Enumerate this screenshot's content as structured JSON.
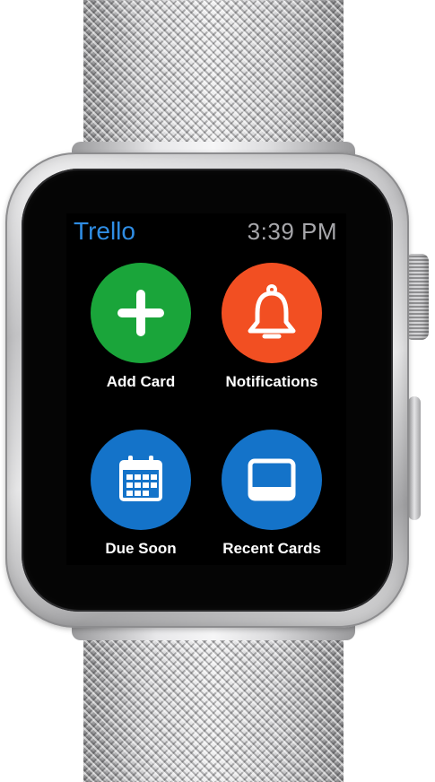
{
  "app": {
    "title": "Trello",
    "time": "3:39 PM"
  },
  "colors": {
    "title_blue": "#2f8de4",
    "add_card_green": "#1aa53a",
    "notifications_orange": "#f24f22",
    "due_soon_blue": "#1473c9",
    "recent_cards_blue": "#1473c9"
  },
  "actions": [
    {
      "label": "Add Card",
      "icon": "plus-icon"
    },
    {
      "label": "Notifications",
      "icon": "bell-icon"
    },
    {
      "label": "Due Soon",
      "icon": "calendar-icon"
    },
    {
      "label": "Recent Cards",
      "icon": "card-icon"
    }
  ]
}
